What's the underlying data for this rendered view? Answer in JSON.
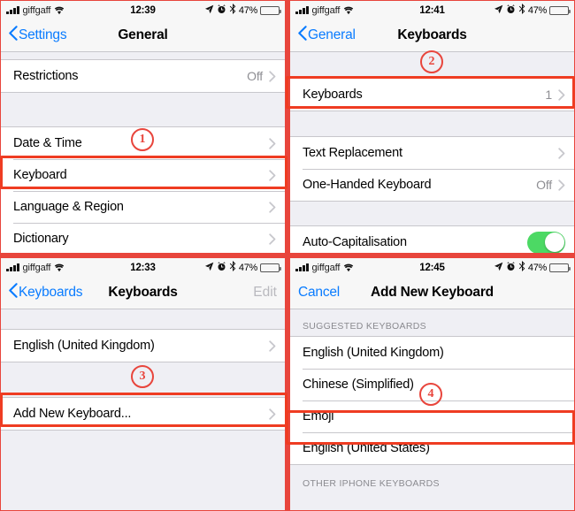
{
  "meta": {
    "accent_red": "#e8453c",
    "ios_blue": "#0a7cff",
    "toggle_green": "#4cd964",
    "list_bg": "#efeff4"
  },
  "panels": [
    {
      "id": "general",
      "statusbar": {
        "carrier": "giffgaff",
        "time": "12:39",
        "battery_pct": "47%"
      },
      "nav": {
        "back": "Settings",
        "title": "General",
        "right": ""
      },
      "rows": [
        {
          "label": "Restrictions",
          "value": "Off",
          "chevron": true
        },
        {
          "label": "Date & Time",
          "value": "",
          "chevron": true
        },
        {
          "label": "Keyboard",
          "value": "",
          "chevron": true
        },
        {
          "label": "Language & Region",
          "value": "",
          "chevron": true
        },
        {
          "label": "Dictionary",
          "value": "",
          "chevron": true
        }
      ],
      "badge": "1"
    },
    {
      "id": "keyboard-settings",
      "statusbar": {
        "carrier": "giffgaff",
        "time": "12:41",
        "battery_pct": "47%"
      },
      "nav": {
        "back": "General",
        "title": "Keyboards",
        "right": ""
      },
      "rows": [
        {
          "label": "Keyboards",
          "value": "1",
          "chevron": true
        },
        {
          "label": "Text Replacement",
          "value": "",
          "chevron": true
        },
        {
          "label": "One-Handed Keyboard",
          "value": "Off",
          "chevron": true
        },
        {
          "label": "Auto-Capitalisation",
          "value": "",
          "chevron": false,
          "toggle": true
        }
      ],
      "badge": "2"
    },
    {
      "id": "keyboards-list",
      "statusbar": {
        "carrier": "giffgaff",
        "time": "12:33",
        "battery_pct": "47%"
      },
      "nav": {
        "back": "Keyboards",
        "title": "Keyboards",
        "right": "Edit"
      },
      "rows": [
        {
          "label": "English (United Kingdom)",
          "value": "",
          "chevron": true
        },
        {
          "label": "Add New Keyboard...",
          "value": "",
          "chevron": true
        }
      ],
      "badge": "3"
    },
    {
      "id": "add-new-keyboard",
      "statusbar": {
        "carrier": "giffgaff",
        "time": "12:45",
        "battery_pct": "47%"
      },
      "nav": {
        "back": "",
        "cancel": "Cancel",
        "title": "Add New Keyboard",
        "right": ""
      },
      "section_header": "SUGGESTED KEYBOARDS",
      "section_header_2": "OTHER IPHONE KEYBOARDS",
      "rows": [
        {
          "label": "English (United Kingdom)",
          "value": "",
          "chevron": false
        },
        {
          "label": "Chinese (Simplified)",
          "value": "",
          "chevron": false
        },
        {
          "label": "Emoji",
          "value": "",
          "chevron": false
        },
        {
          "label": "English (United States)",
          "value": "",
          "chevron": false
        }
      ],
      "badge": "4"
    }
  ]
}
